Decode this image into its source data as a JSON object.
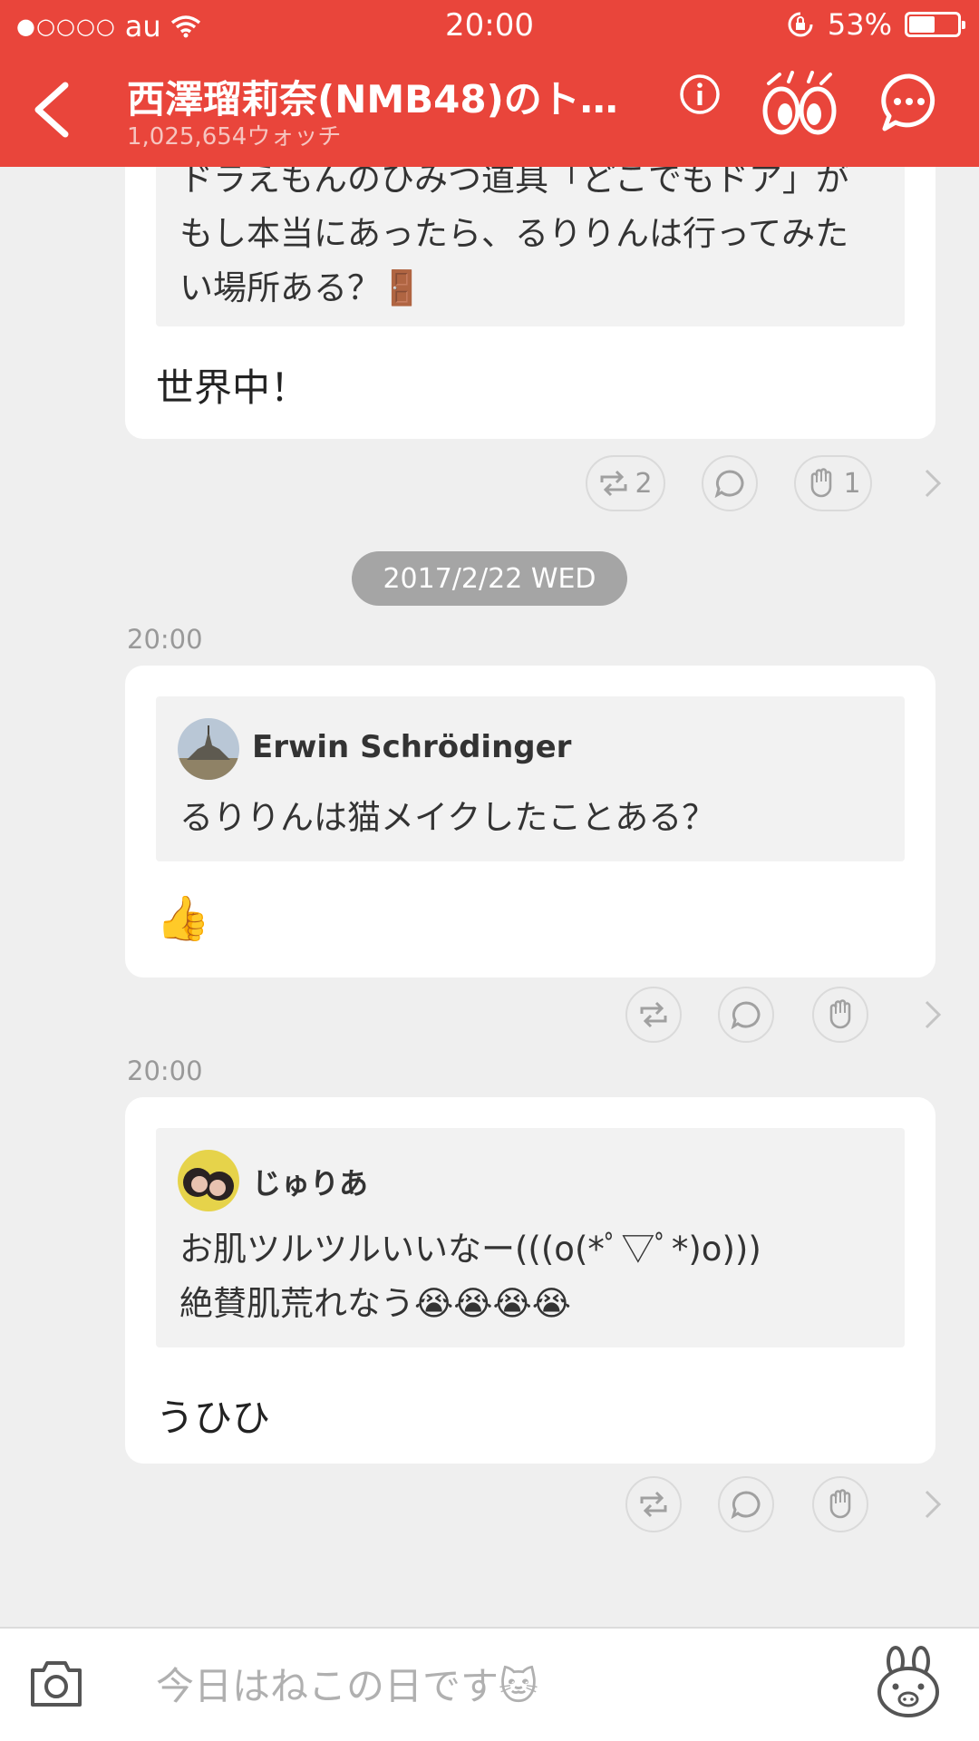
{
  "status_bar": {
    "signal": "●○○○○",
    "carrier": "au",
    "time": "20:00",
    "battery": "53%"
  },
  "header": {
    "title": "西澤瑠莉奈(NMB48)のト…",
    "subtitle": "1,025,654ウォッチ"
  },
  "posts": [
    {
      "quote_text_lines": [
        "ドラえもんのひみつ道具「どこでもドア」が",
        "もし本当にあったら、るりりんは行ってみた",
        "い場所ある？🚪"
      ],
      "reply": "世界中！",
      "retweet_count": "2",
      "clap_count": "1"
    },
    {
      "date_label": "2017/2/22 WED",
      "time": "20:00",
      "quote_author": "Erwin Schrödinger",
      "quote_text": "るりりんは猫メイクしたことある？",
      "reply": "👍"
    },
    {
      "time": "20:00",
      "quote_author": "じゅりあ",
      "quote_text_lines": [
        "お肌ツルツルいいなー(((o(*ﾟ▽ﾟ*)o)))",
        "絶賛肌荒れなう😭😭😭😭"
      ],
      "reply": "うひひ"
    }
  ],
  "input": {
    "placeholder": "今日はねこの日です🐱"
  },
  "colors": {
    "accent": "#e9453b",
    "background": "#efefef",
    "card": "#ffffff",
    "quote_bg": "#f2f2f2"
  },
  "icons": [
    "back-arrow-icon",
    "info-icon",
    "watch-eyes-icon",
    "chat-bubble-icon",
    "retweet-icon",
    "comment-icon",
    "clap-icon",
    "chevron-right-icon",
    "camera-icon",
    "bunny-stamp-icon"
  ]
}
